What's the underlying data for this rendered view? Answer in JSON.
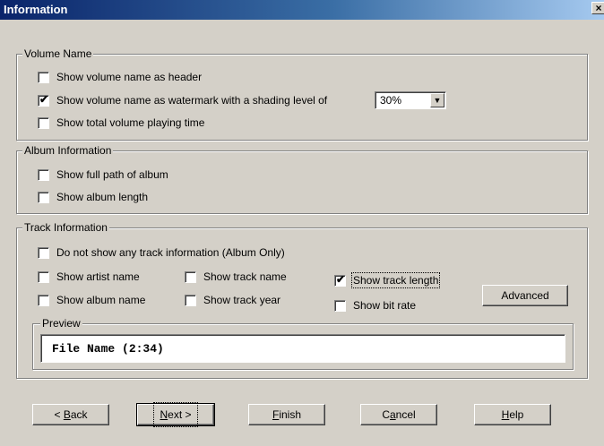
{
  "window": {
    "title": "Information",
    "close_glyph": "×"
  },
  "volume_group": {
    "legend": "Volume Name",
    "options": [
      {
        "label": "Show volume name as header",
        "checked": false
      },
      {
        "label": "Show volume name as watermark with a shading level of",
        "checked": true
      },
      {
        "label": "Show total volume playing time",
        "checked": false
      }
    ],
    "shading_select": {
      "value": "30%"
    }
  },
  "album_group": {
    "legend": "Album Information",
    "options": [
      {
        "label": "Show full path of album",
        "checked": false
      },
      {
        "label": "Show album length",
        "checked": false
      }
    ]
  },
  "track_group": {
    "legend": "Track Information",
    "no_track_info": {
      "label": "Do not show any track information (Album Only)",
      "checked": false
    },
    "artist_name": {
      "label": "Show artist name",
      "checked": false
    },
    "track_name": {
      "label": "Show track name",
      "checked": false
    },
    "track_length": {
      "label": "Show track length",
      "checked": true
    },
    "album_name": {
      "label": "Show album name",
      "checked": false
    },
    "track_year": {
      "label": "Show track year",
      "checked": false
    },
    "bit_rate": {
      "label": "Show bit rate",
      "checked": false
    },
    "advanced_label": "Advanced",
    "preview": {
      "legend": "Preview",
      "text": "File Name (2:34)"
    }
  },
  "buttons": {
    "back": {
      "prefix": "< ",
      "mnemonic": "B",
      "rest": "ack"
    },
    "next": {
      "mnemonic": "N",
      "rest": "ext >"
    },
    "finish": {
      "mnemonic": "F",
      "rest": "inish"
    },
    "cancel": {
      "prefix": "C",
      "mnemonic": "a",
      "rest": "ncel"
    },
    "help": {
      "mnemonic": "H",
      "rest": "elp"
    }
  },
  "check_glyph": "✔",
  "icons": {
    "close": "close-icon",
    "dropdown": "chevron-down-icon"
  }
}
